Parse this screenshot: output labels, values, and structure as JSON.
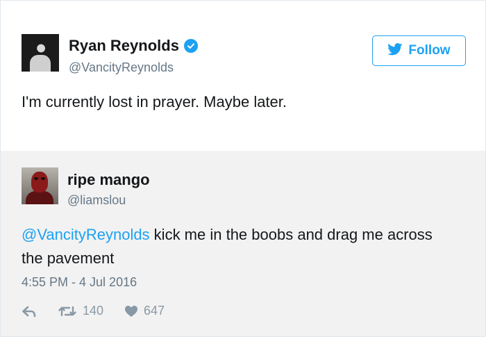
{
  "main_tweet": {
    "name": "Ryan Reynolds",
    "handle": "@VancityReynolds",
    "text": "I'm currently lost in prayer. Maybe later.",
    "follow_label": "Follow",
    "verified": true
  },
  "reply_tweet": {
    "name": "ripe mango",
    "handle": "@liamslou",
    "mention": "@VancityReynolds",
    "text": " kick me in the boobs and drag me across the pavement",
    "timestamp": "4:55 PM - 4 Jul 2016",
    "retweets": "140",
    "likes": "647"
  },
  "colors": {
    "accent": "#1da1f2",
    "text": "#14171a",
    "muted": "#657786",
    "reply_bg": "#f2f2f2"
  },
  "icons": [
    "verified-badge-icon",
    "twitter-bird-icon",
    "reply-icon",
    "retweet-icon",
    "heart-icon"
  ]
}
